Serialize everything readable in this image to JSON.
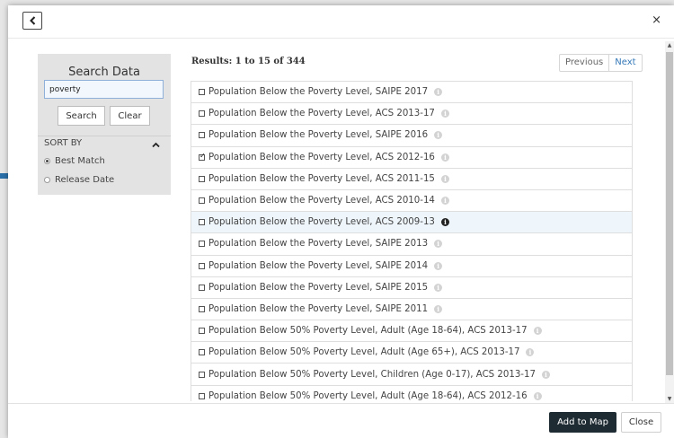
{
  "header": {
    "back_icon": "chevron-left-icon",
    "close_label": "×"
  },
  "sidebar": {
    "title": "Search Data",
    "search_value": "poverty",
    "search_button": "Search",
    "clear_button": "Clear",
    "sort_label": "SORT BY",
    "sort_options": [
      {
        "label": "Best Match",
        "selected": true
      },
      {
        "label": "Release Date",
        "selected": false
      }
    ]
  },
  "results": {
    "title": "Results: 1 to 15 of 344",
    "previous": "Previous",
    "next": "Next",
    "items": [
      {
        "label": "Population Below the Poverty Level, SAIPE 2017",
        "checked": false,
        "highlighted": false
      },
      {
        "label": "Population Below the Poverty Level, ACS 2013-17",
        "checked": false,
        "highlighted": false
      },
      {
        "label": "Population Below the Poverty Level, SAIPE 2016",
        "checked": false,
        "highlighted": false
      },
      {
        "label": "Population Below the Poverty Level, ACS 2012-16",
        "checked": true,
        "highlighted": false
      },
      {
        "label": "Population Below the Poverty Level, ACS 2011-15",
        "checked": false,
        "highlighted": false
      },
      {
        "label": "Population Below the Poverty Level, ACS 2010-14",
        "checked": false,
        "highlighted": false
      },
      {
        "label": "Population Below the Poverty Level, ACS 2009-13",
        "checked": false,
        "highlighted": true
      },
      {
        "label": "Population Below the Poverty Level, SAIPE 2013",
        "checked": false,
        "highlighted": false
      },
      {
        "label": "Population Below the Poverty Level, SAIPE 2014",
        "checked": false,
        "highlighted": false
      },
      {
        "label": "Population Below the Poverty Level, SAIPE 2015",
        "checked": false,
        "highlighted": false
      },
      {
        "label": "Population Below the Poverty Level, SAIPE 2011",
        "checked": false,
        "highlighted": false
      },
      {
        "label": "Population Below 50% Poverty Level, Adult (Age 18-64), ACS 2013-17",
        "checked": false,
        "highlighted": false
      },
      {
        "label": "Population Below 50% Poverty Level, Adult (Age 65+), ACS 2013-17",
        "checked": false,
        "highlighted": false
      },
      {
        "label": "Population Below 50% Poverty Level, Children (Age 0-17), ACS 2013-17",
        "checked": false,
        "highlighted": false
      },
      {
        "label": "Population Below 50% Poverty Level, Adult (Age 18-64), ACS 2012-16",
        "checked": false,
        "highlighted": false
      }
    ]
  },
  "footer": {
    "add_button": "Add to Map",
    "close_button": "Close"
  },
  "colors": {
    "accent_arrow": "#2a6fa8",
    "primary_button": "#1f2b33",
    "highlight_row": "#eef5fb",
    "link": "#3579b8"
  }
}
